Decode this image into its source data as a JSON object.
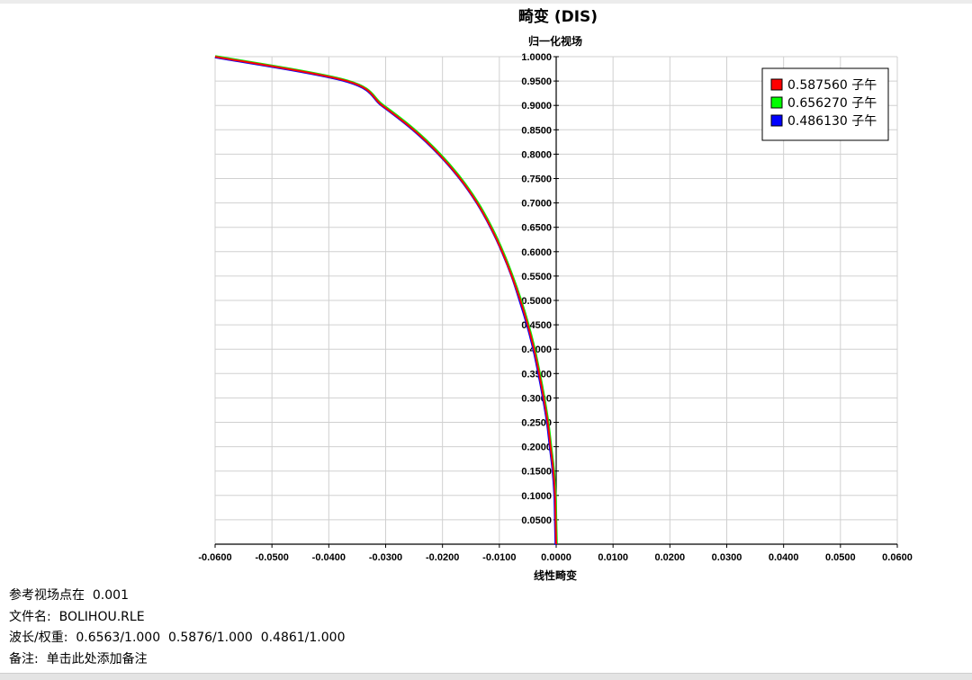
{
  "chart_data": {
    "type": "line",
    "title": "畸变 (DIS)",
    "ylabel": "归一化视场",
    "xlabel": "线性畸变",
    "xlim": [
      -0.06,
      0.06
    ],
    "ylim": [
      0.0,
      1.0
    ],
    "x_ticks": [
      "-0.0600",
      "-0.0500",
      "-0.0400",
      "-0.0300",
      "-0.0200",
      "-0.0100",
      "0.0000",
      "0.0100",
      "0.0200",
      "0.0300",
      "0.0400",
      "0.0500",
      "0.0600"
    ],
    "y_ticks": [
      "0.0500",
      "0.1000",
      "0.1500",
      "0.2000",
      "0.2500",
      "0.3000",
      "0.3500",
      "0.4000",
      "0.4500",
      "0.5000",
      "0.5500",
      "0.6000",
      "0.6500",
      "0.7000",
      "0.7500",
      "0.8000",
      "0.8500",
      "0.9000",
      "0.9500",
      "1.0000"
    ],
    "grid": true,
    "legend_position": "top-right",
    "series": [
      {
        "name": "0.587560 子午",
        "color": "#ff0000",
        "points": [
          [
            0.0,
            0.0
          ],
          [
            -0.0001,
            0.05
          ],
          [
            -0.0002,
            0.1
          ],
          [
            -0.0005,
            0.15
          ],
          [
            -0.001,
            0.2
          ],
          [
            -0.0015,
            0.25
          ],
          [
            -0.0022,
            0.3
          ],
          [
            -0.003,
            0.35
          ],
          [
            -0.0039,
            0.4
          ],
          [
            -0.005,
            0.45
          ],
          [
            -0.0063,
            0.5
          ],
          [
            -0.0078,
            0.55
          ],
          [
            -0.0095,
            0.6
          ],
          [
            -0.0115,
            0.65
          ],
          [
            -0.0139,
            0.7
          ],
          [
            -0.0169,
            0.75
          ],
          [
            -0.0206,
            0.8
          ],
          [
            -0.0251,
            0.85
          ],
          [
            -0.0306,
            0.9
          ],
          [
            -0.0368,
            0.95
          ],
          [
            -0.06,
            1.0
          ]
        ]
      },
      {
        "name": "0.656270 子午",
        "color": "#00ff00",
        "points": [
          [
            0.0,
            0.0
          ],
          [
            -0.0001,
            0.05
          ],
          [
            -0.0002,
            0.1
          ],
          [
            -0.0005,
            0.15
          ],
          [
            -0.001,
            0.2
          ],
          [
            -0.0015,
            0.25
          ],
          [
            -0.0022,
            0.3
          ],
          [
            -0.003,
            0.35
          ],
          [
            -0.0039,
            0.4
          ],
          [
            -0.005,
            0.45
          ],
          [
            -0.0063,
            0.5
          ],
          [
            -0.0078,
            0.55
          ],
          [
            -0.0095,
            0.6
          ],
          [
            -0.0115,
            0.65
          ],
          [
            -0.0139,
            0.7
          ],
          [
            -0.0169,
            0.75
          ],
          [
            -0.0206,
            0.8
          ],
          [
            -0.0251,
            0.85
          ],
          [
            -0.0306,
            0.9
          ],
          [
            -0.0369,
            0.95
          ],
          [
            -0.0601,
            1.0
          ]
        ]
      },
      {
        "name": "0.486130 子午",
        "color": "#0000ff",
        "points": [
          [
            0.0,
            0.0
          ],
          [
            -0.0001,
            0.05
          ],
          [
            -0.0002,
            0.1
          ],
          [
            -0.0005,
            0.15
          ],
          [
            -0.001,
            0.2
          ],
          [
            -0.0015,
            0.25
          ],
          [
            -0.0022,
            0.3
          ],
          [
            -0.003,
            0.35
          ],
          [
            -0.0039,
            0.4
          ],
          [
            -0.005,
            0.45
          ],
          [
            -0.0063,
            0.5
          ],
          [
            -0.0077,
            0.55
          ],
          [
            -0.0094,
            0.6
          ],
          [
            -0.0114,
            0.65
          ],
          [
            -0.0138,
            0.7
          ],
          [
            -0.0168,
            0.75
          ],
          [
            -0.0205,
            0.8
          ],
          [
            -0.025,
            0.85
          ],
          [
            -0.0305,
            0.9
          ],
          [
            -0.0367,
            0.95
          ],
          [
            -0.0599,
            1.0
          ]
        ]
      }
    ]
  },
  "info": {
    "ref_field": "参考视场点在  0.001",
    "filename": "文件名:  BOLIHOU.RLE",
    "wavelengths": "波长/权重:  0.6563/1.000  0.5876/1.000  0.4861/1.000",
    "note": "备注:  单击此处添加备注"
  }
}
